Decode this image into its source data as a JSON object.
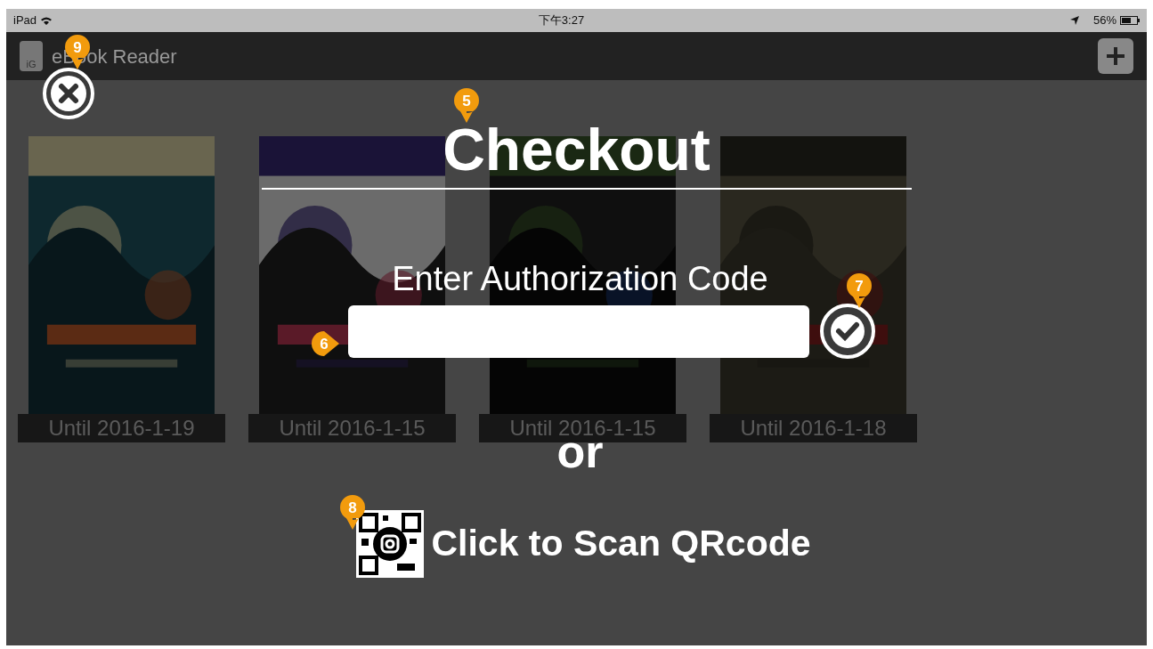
{
  "status_bar": {
    "device": "iPad",
    "time": "下午3:27",
    "battery": "56%"
  },
  "header": {
    "logo_text": "iG",
    "title": "eBook Reader"
  },
  "books": [
    {
      "until": "Until 2016-1-19"
    },
    {
      "until": "Until 2016-1-15"
    },
    {
      "until": "Until 2016-1-15"
    },
    {
      "until": "Until 2016-1-18"
    }
  ],
  "checkout": {
    "title": "Checkout",
    "code_label": "Enter Authorization Code",
    "or": "or",
    "scan_label": "Click to Scan QRcode"
  },
  "markers": [
    {
      "number": "9",
      "kind": "down"
    },
    {
      "number": "5",
      "kind": "down"
    },
    {
      "number": "6",
      "kind": "right"
    },
    {
      "number": "7",
      "kind": "down"
    },
    {
      "number": "8",
      "kind": "down"
    }
  ]
}
